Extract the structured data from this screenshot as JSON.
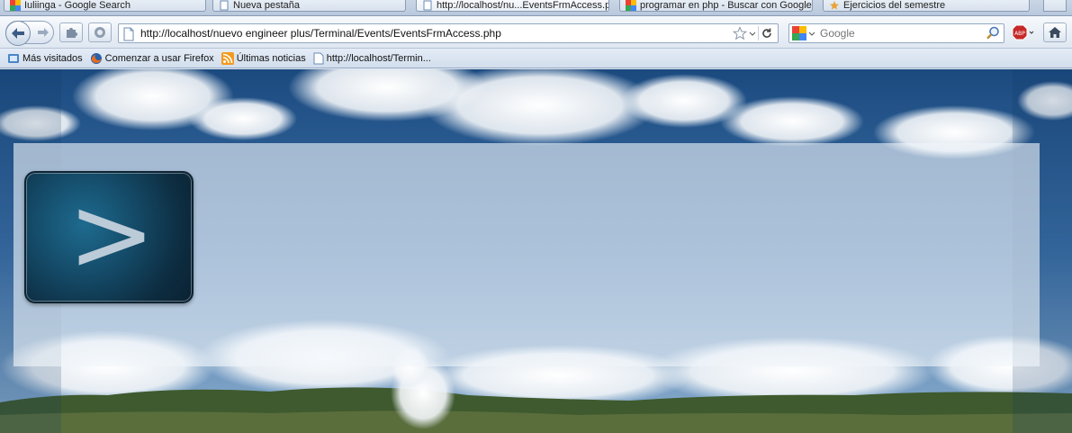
{
  "tabs": [
    {
      "label": "Iuliinga - Google Search",
      "active": false
    },
    {
      "label": "Nueva pestaña",
      "active": false
    },
    {
      "label": "http://localhost/nu...EventsFrmAccess.php",
      "active": true
    },
    {
      "label": "programar en php - Buscar con Google",
      "active": false
    },
    {
      "label": "Ejercicios del semestre",
      "active": false
    }
  ],
  "navbar": {
    "url": "http://localhost/nuevo engineer plus/Terminal/Events/EventsFrmAccess.php",
    "search_placeholder": "Google",
    "search_engine_icon": "google-icon",
    "addon_icon": "adblock-icon",
    "home_icon": "home-icon"
  },
  "bookmarks": [
    {
      "label": "Más visitados",
      "icon": "most-visited-icon"
    },
    {
      "label": "Comenzar a usar Firefox",
      "icon": "firefox-icon"
    },
    {
      "label": "Últimas noticias",
      "icon": "rss-icon"
    },
    {
      "label": "http://localhost/Termin...",
      "icon": "page-icon"
    }
  ],
  "page": {
    "enter_button_glyph": ">",
    "accent": "#154e6c",
    "sky_color": "#1e4f86"
  }
}
